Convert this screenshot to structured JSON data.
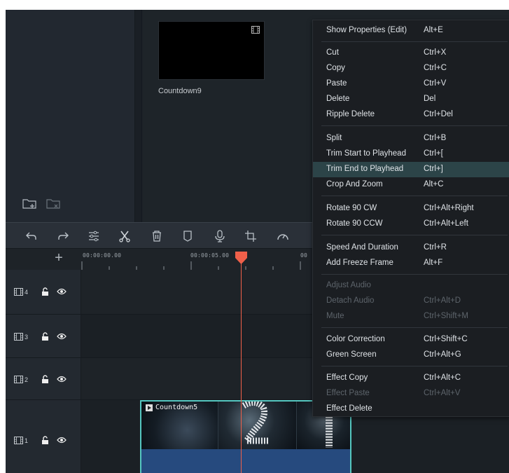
{
  "media": {
    "clip_label": "Countdown9"
  },
  "toolbar": {
    "icons": [
      "undo-icon",
      "redo-icon",
      "adjust-icon",
      "cut-icon",
      "delete-icon",
      "marker-icon",
      "voiceover-icon",
      "crop-icon",
      "speed-icon"
    ]
  },
  "ruler": {
    "timecode_start": "00:00:00.00",
    "timecode_mid": "00:00:05.00",
    "timecode_cut": "00"
  },
  "tracks": [
    {
      "number": "4"
    },
    {
      "number": "3"
    },
    {
      "number": "2"
    },
    {
      "number": "1"
    }
  ],
  "clip": {
    "title": "Countdown5",
    "border_color": "#55c7c0"
  },
  "playhead": {
    "color": "#f0604a"
  },
  "menu": {
    "highlight_color": "#2c4448",
    "items": [
      {
        "label": "Show Properties (Edit)",
        "shortcut": "Alt+E"
      },
      {
        "label": "Cut",
        "shortcut": "Ctrl+X"
      },
      {
        "label": "Copy",
        "shortcut": "Ctrl+C"
      },
      {
        "label": "Paste",
        "shortcut": "Ctrl+V"
      },
      {
        "label": "Delete",
        "shortcut": "Del"
      },
      {
        "label": "Ripple Delete",
        "shortcut": "Ctrl+Del"
      },
      {
        "label": "Split",
        "shortcut": "Ctrl+B"
      },
      {
        "label": "Trim Start to Playhead",
        "shortcut": "Ctrl+["
      },
      {
        "label": "Trim End to Playhead",
        "shortcut": "Ctrl+]",
        "highlighted": true
      },
      {
        "label": "Crop And Zoom",
        "shortcut": "Alt+C"
      },
      {
        "label": "Rotate 90 CW",
        "shortcut": "Ctrl+Alt+Right"
      },
      {
        "label": "Rotate 90 CCW",
        "shortcut": "Ctrl+Alt+Left"
      },
      {
        "label": "Speed And Duration",
        "shortcut": "Ctrl+R"
      },
      {
        "label": "Add Freeze Frame",
        "shortcut": "Alt+F"
      },
      {
        "label": "Adjust Audio",
        "shortcut": "",
        "disabled": true
      },
      {
        "label": "Detach Audio",
        "shortcut": "Ctrl+Alt+D",
        "disabled": true
      },
      {
        "label": "Mute",
        "shortcut": "Ctrl+Shift+M",
        "disabled": true
      },
      {
        "label": "Color Correction",
        "shortcut": "Ctrl+Shift+C"
      },
      {
        "label": "Green Screen",
        "shortcut": "Ctrl+Alt+G"
      },
      {
        "label": "Effect Copy",
        "shortcut": "Ctrl+Alt+C"
      },
      {
        "label": "Effect Paste",
        "shortcut": "Ctrl+Alt+V",
        "disabled": true
      },
      {
        "label": "Effect Delete",
        "shortcut": ""
      }
    ]
  }
}
